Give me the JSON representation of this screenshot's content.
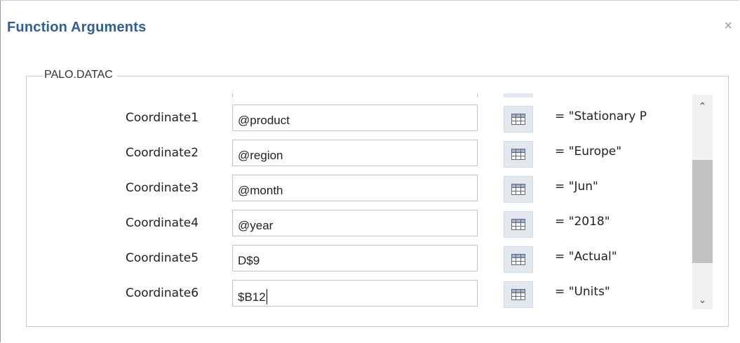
{
  "dialog": {
    "title": "Function Arguments",
    "close_glyph": "×",
    "group_label": "PALO.DATAC"
  },
  "arguments": [
    {
      "label": "Coordinate1",
      "input": "@product",
      "value": "= \"Stationary P"
    },
    {
      "label": "Coordinate2",
      "input": "@region",
      "value": "= \"Europe\""
    },
    {
      "label": "Coordinate3",
      "input": "@month",
      "value": "= \"Jun\""
    },
    {
      "label": "Coordinate4",
      "input": "@year",
      "value": "= \"2018\""
    },
    {
      "label": "Coordinate5",
      "input": "D$9",
      "value": "= \"Actual\""
    },
    {
      "label": "Coordinate6",
      "input": "$B12",
      "value": "= \"Units\""
    }
  ],
  "scrollbar": {
    "up_glyph": "⌃",
    "down_glyph": "⌄"
  },
  "icons": {
    "close": "close-icon",
    "range_select": "range-select-icon",
    "scroll_up": "chevron-up-icon",
    "scroll_down": "chevron-down-icon"
  },
  "colors": {
    "title": "#2f5f9a",
    "ref_button_bg": "#e3e8f0",
    "scrollbar_thumb": "#c2c2c2"
  }
}
